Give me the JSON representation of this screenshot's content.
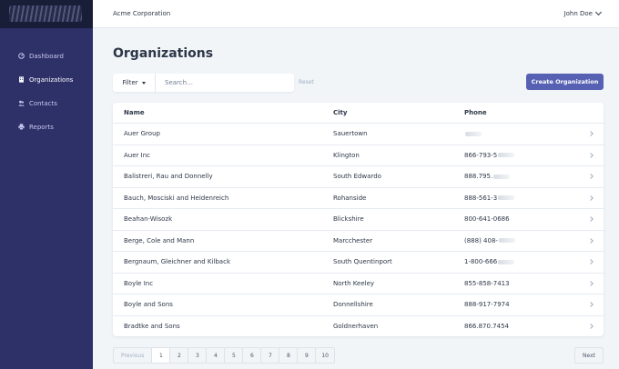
{
  "header": {
    "company": "Acme Corporation",
    "user": "John Doe"
  },
  "sidebar": {
    "items": [
      {
        "label": "Dashboard",
        "icon": "dashboard-icon",
        "active": false
      },
      {
        "label": "Organizations",
        "icon": "building-icon",
        "active": true
      },
      {
        "label": "Contacts",
        "icon": "users-icon",
        "active": false
      },
      {
        "label": "Reports",
        "icon": "printer-icon",
        "active": false
      }
    ]
  },
  "main": {
    "title": "Organizations",
    "filter_label": "Filter",
    "search_placeholder": "Search…",
    "reset_label": "Reset",
    "create_label": "Create Organization"
  },
  "table": {
    "columns": [
      "Name",
      "City",
      "Phone"
    ],
    "rows": [
      {
        "name": "Auer Group",
        "city": "Sauertown",
        "phone": ""
      },
      {
        "name": "Auer Inc",
        "city": "Klington",
        "phone": "866-793-5"
      },
      {
        "name": "Balistreri, Rau and Donnelly",
        "city": "South Edwardo",
        "phone": "888.795."
      },
      {
        "name": "Bauch, Mosciski and Heidenreich",
        "city": "Rohanside",
        "phone": "888-561-3"
      },
      {
        "name": "Beahan-Wisozk",
        "city": "Blickshire",
        "phone": "800-641-0686"
      },
      {
        "name": "Berge, Cole and Mann",
        "city": "Marcchester",
        "phone": "(888) 408-"
      },
      {
        "name": "Bergnaum, Gleichner and Kilback",
        "city": "South Quentinport",
        "phone": "1-800-666"
      },
      {
        "name": "Boyle Inc",
        "city": "North Keeley",
        "phone": "855-858-7413"
      },
      {
        "name": "Boyle and Sons",
        "city": "Donnellshire",
        "phone": "888-917-7974"
      },
      {
        "name": "Bradtke and Sons",
        "city": "Goldnerhaven",
        "phone": "866.870.7454"
      }
    ]
  },
  "pagination": {
    "prev": "Previous",
    "pages": [
      "1",
      "2",
      "3",
      "4",
      "5",
      "6",
      "7",
      "8",
      "9",
      "10"
    ],
    "active": "1",
    "next": "Next"
  },
  "colors": {
    "sidebar": "#2e3068",
    "logo_bar": "#191e38",
    "accent": "#5661b3",
    "background": "#f1f5f8"
  }
}
